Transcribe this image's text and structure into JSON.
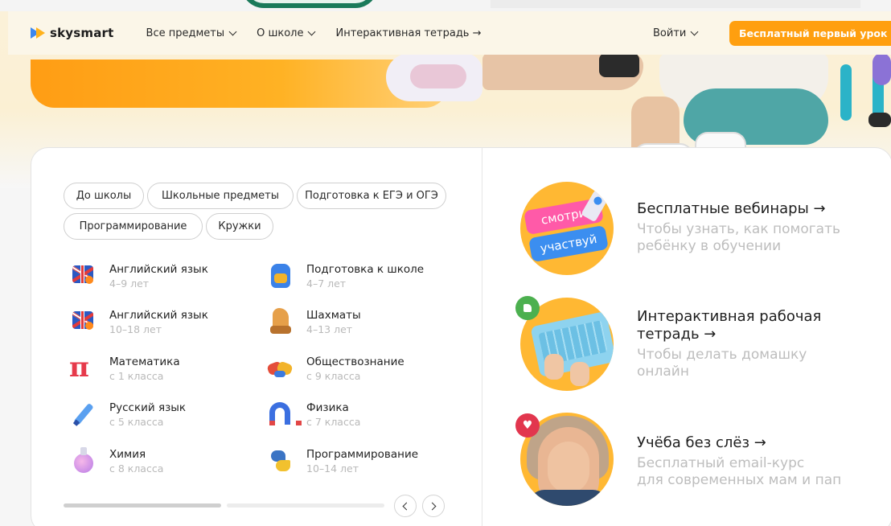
{
  "brand": {
    "name": "skysmart"
  },
  "nav": {
    "items": [
      {
        "label": "Все предметы",
        "dropdown": true
      },
      {
        "label": "О школе",
        "dropdown": true
      },
      {
        "label": "Интерактивная тетрадь →",
        "dropdown": false
      }
    ],
    "login_label": "Войти",
    "cta_label": "Бесплатный первый урок"
  },
  "categories": [
    "До школы",
    "Школьные предметы",
    "Подготовка к ЕГЭ и ОГЭ",
    "Программирование",
    "Кружки"
  ],
  "subjects": [
    {
      "name": "Английский язык",
      "age": "4–9 лет",
      "icon": "uk-flag-icon"
    },
    {
      "name": "Подготовка к школе",
      "age": "4–7 лет",
      "icon": "backpack-icon"
    },
    {
      "name": "Английский язык",
      "age": "10–18 лет",
      "icon": "uk-flag-icon"
    },
    {
      "name": "Шахматы",
      "age": "4–13 лет",
      "icon": "chess-knight-icon"
    },
    {
      "name": "Математика",
      "age": "с 1 класса",
      "icon": "pi-icon"
    },
    {
      "name": "Обществознание",
      "age": "с 9 класса",
      "icon": "handshake-icon"
    },
    {
      "name": "Русский язык",
      "age": "с 5 класса",
      "icon": "pen-icon"
    },
    {
      "name": "Физика",
      "age": "с 7 класса",
      "icon": "magnet-icon"
    },
    {
      "name": "Химия",
      "age": "с 8 класса",
      "icon": "flask-icon"
    },
    {
      "name": "Программирование",
      "age": "10–14 лет",
      "icon": "python-icon"
    }
  ],
  "promos": [
    {
      "title": "Бесплатные вебинары →",
      "subtitle_lines": [
        "Чтобы узнать, как помогать",
        "ребёнку в обучении"
      ],
      "badge_top": "смотри",
      "badge_bottom": "участвуй"
    },
    {
      "title_lines": [
        "Интерактивная рабочая",
        "тетрадь →"
      ],
      "subtitle_lines": [
        "Чтобы делать домашку",
        "онлайн"
      ]
    },
    {
      "title": "Учёба без слёз →",
      "subtitle_lines": [
        "Бесплатный email-курс",
        "для современных мам и пап"
      ]
    }
  ],
  "colors": {
    "accent": "#ff9f0f",
    "hero_bg": "#fbf1d9",
    "muted_text": "#bdbdbd"
  }
}
